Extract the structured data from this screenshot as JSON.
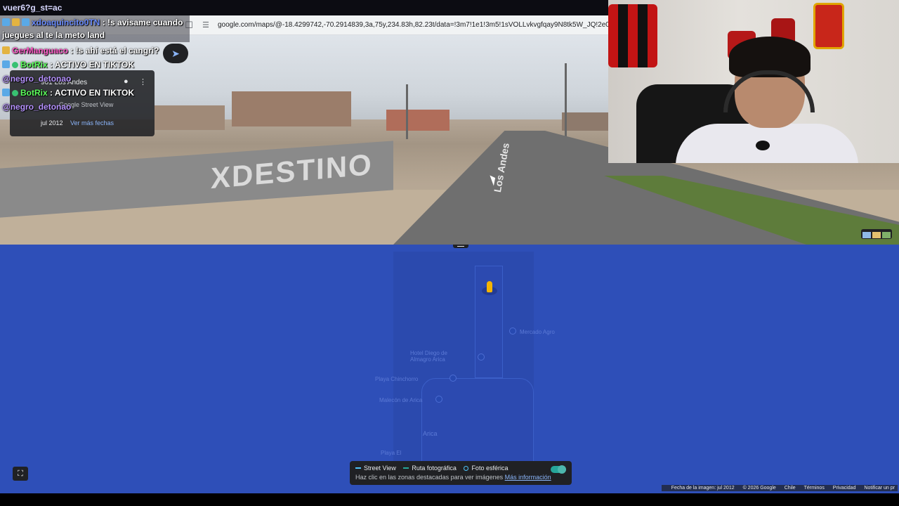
{
  "top_strip": {
    "text": "vuer6?g_st=ac"
  },
  "browser": {
    "url": "google.com/maps/@-18.4299742,-70.2914839,3a,75y,234.83h,82.23t/data=!3m7!1e1!3m5!1sVOLLvkvgfqay9N8tk5W_JQ!2e0!6shttps",
    "bookmark_icon": "bookmark-icon",
    "site_settings_icon": "tune-icon"
  },
  "chat": {
    "messages": [
      {
        "user": "xdoaquincito0TN",
        "text": ": !s avisame cuando juegues al te la meto land",
        "user_color": "#6a8cff"
      },
      {
        "user": "GerManguaco",
        "text": ": !s ahí está el cangri?",
        "user_color": "#ff5ac8"
      },
      {
        "user": "BotRix",
        "text": ": ACTIVO EN TIKTOK",
        "user_color": "#5cff5c"
      },
      {
        "user": "",
        "text": "@negro_detonao",
        "user_color": "#b692ff"
      },
      {
        "user": "BotRix",
        "text": ": ACTIVO EN TIKTOK",
        "user_color": "#5cff5c"
      },
      {
        "user": "",
        "text": "@negro_detonao",
        "user_color": "#b692ff"
      }
    ]
  },
  "street_view_card": {
    "address": "961 Los Andes",
    "source": "Google Street View",
    "date": "jul 2012",
    "see_more_dates": "Ver más fechas"
  },
  "street_view": {
    "road_label": "Los Andes",
    "graffiti": "XDESTINO"
  },
  "map": {
    "labels": [
      {
        "text": "Mercado Agro"
      },
      {
        "text": "Playa Chinchorro"
      },
      {
        "text": "Hotel Diego de Almagro Arica"
      },
      {
        "text": "Malecón de Arica"
      },
      {
        "text": "Arica"
      },
      {
        "text": "Playa El"
      }
    ],
    "legend": {
      "street_view": "Street View",
      "photo_route": "Ruta fotográfica",
      "spherical_photo": "Foto esférica",
      "hint": "Haz clic en las zonas destacadas para ver imágenes",
      "more_info": "Más información"
    }
  },
  "footer": {
    "image_date": "Fecha de la imagen: jul 2012",
    "copyright": "© 2026 Google",
    "country": "Chile",
    "terms": "Términos",
    "privacy": "Privacidad",
    "report": "Notificar un pr"
  },
  "colors": {
    "map_blue": "#2e4fb8",
    "maps_dark": "#202124",
    "link_blue": "#8ab4f8"
  }
}
